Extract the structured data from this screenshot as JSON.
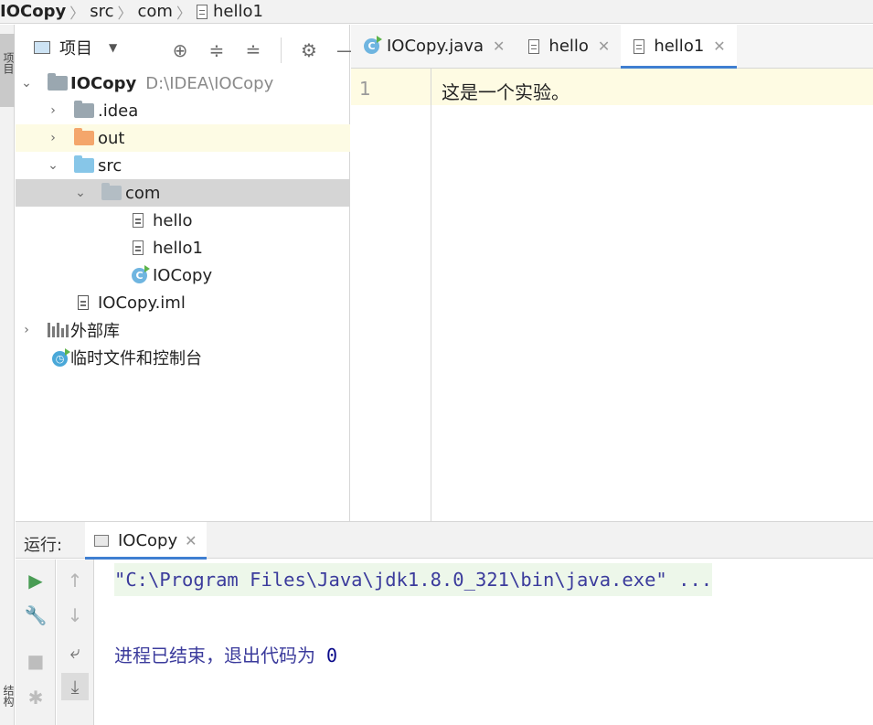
{
  "breadcrumb": {
    "project": "IOCopy",
    "src": "src",
    "package": "com",
    "file": "hello1"
  },
  "left_strip": {
    "project_label": "项目",
    "structure_label": "结构"
  },
  "project_panel": {
    "title": "项目",
    "tree": {
      "root_name": "IOCopy",
      "root_path": "D:\\IDEA\\IOCopy",
      "idea": ".idea",
      "out": "out",
      "src": "src",
      "com": "com",
      "hello": "hello",
      "hello1": "hello1",
      "iocopy_class": "IOCopy",
      "iml": "IOCopy.iml",
      "libraries": "外部库",
      "scratches": "临时文件和控制台"
    },
    "colors": {
      "folder_gray": "#9aa7b0",
      "folder_out": "#f4a66b",
      "folder_src": "#87c6e8",
      "selected_row": "#d5d5d5",
      "hover_row": "#fdfbe4"
    }
  },
  "editor": {
    "tabs": [
      {
        "label": "IOCopy.java",
        "icon": "class-icon"
      },
      {
        "label": "hello",
        "icon": "text-file-icon"
      },
      {
        "label": "hello1",
        "icon": "text-file-icon",
        "active": true
      }
    ],
    "line_number": "1",
    "line_content": "这是一个实验。"
  },
  "run_panel": {
    "label": "运行:",
    "tab_label": "IOCopy",
    "command_line": "\"C:\\Program Files\\Java\\jdk1.8.0_321\\bin\\java.exe\" ...",
    "exit_message": "进程已结束，退出代码为",
    "exit_code": "0"
  },
  "colors": {
    "accent": "#3f7fd1",
    "run_green": "#499c54",
    "console_text": "#3b3b9c"
  }
}
